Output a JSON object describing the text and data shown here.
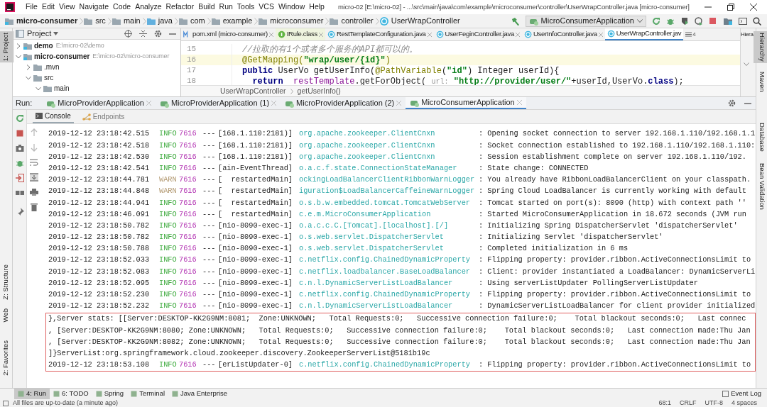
{
  "window": {
    "title": "micro-02 [E:\\micro-02] - ...\\src\\main\\java\\com\\example\\microconsumer\\controller\\UserWrapController.java [micro-consumer]"
  },
  "menu": [
    "File",
    "Edit",
    "View",
    "Navigate",
    "Code",
    "Analyze",
    "Refactor",
    "Build",
    "Run",
    "Tools",
    "VCS",
    "Window",
    "Help"
  ],
  "breadcrumbs": [
    {
      "label": "micro-consumer",
      "kind": "module"
    },
    {
      "label": "src",
      "kind": "folder"
    },
    {
      "label": "main",
      "kind": "folder"
    },
    {
      "label": "java",
      "kind": "source"
    },
    {
      "label": "com",
      "kind": "folder"
    },
    {
      "label": "example",
      "kind": "folder"
    },
    {
      "label": "microconsumer",
      "kind": "folder"
    },
    {
      "label": "controller",
      "kind": "folder"
    },
    {
      "label": "UserWrapController",
      "kind": "class"
    }
  ],
  "run_config": "MicroConsumerApplication",
  "left_stripe": [
    {
      "label": "1: Project",
      "selected": true
    },
    {
      "label": "Z: Structure",
      "selected": false
    },
    {
      "label": "Web",
      "selected": false
    },
    {
      "label": "2: Favorites",
      "selected": false
    }
  ],
  "right_stripe": [
    {
      "label": "Hierarchy",
      "selected": true
    },
    {
      "label": "Maven",
      "selected": false
    },
    {
      "label": "Database",
      "selected": false
    },
    {
      "label": "Bean Validation",
      "selected": false
    }
  ],
  "project": {
    "title": "Project",
    "tree": [
      {
        "name": "demo",
        "path": "E:\\micro-02\\demo",
        "kind": "module",
        "expanded": false
      },
      {
        "name": "micro-consumer",
        "path": "E:\\micro-02\\micro-consumer",
        "kind": "module",
        "expanded": true,
        "children": [
          {
            "name": ".mvn",
            "kind": "folder",
            "expanded": false
          },
          {
            "name": "src",
            "kind": "folder",
            "expanded": true,
            "children": [
              {
                "name": "main",
                "kind": "folder",
                "expanded": true
              }
            ]
          }
        ]
      }
    ]
  },
  "editor": {
    "tabs": [
      {
        "label": "pom.xml (micro-consumer)",
        "kind": "maven",
        "selected": false
      },
      {
        "label": "IRule.class",
        "kind": "interface",
        "selected": false
      },
      {
        "label": "RestTemplateConfiguration.java",
        "kind": "class",
        "selected": false
      },
      {
        "label": "UserFeginController.java",
        "kind": "class",
        "selected": false
      },
      {
        "label": "UserInfoController.java",
        "kind": "class",
        "selected": false
      },
      {
        "label": "UserWrapController.jav",
        "kind": "class",
        "selected": true
      }
    ],
    "overflow": "4",
    "side_panel": "Hiera",
    "lines": [
      {
        "number": "15",
        "highlighted": false,
        "tokens": [
          {
            "text": "//拉取的有1个或者多个服务的API都可以的。",
            "kind": "comment"
          }
        ]
      },
      {
        "number": "16",
        "highlighted": true,
        "tokens": [
          {
            "text": "@GetMapping(",
            "kind": "annotation"
          },
          {
            "text": "\"wrap/user/{id}\"",
            "kind": "string"
          },
          {
            "text": ")",
            "kind": "annotation"
          }
        ]
      },
      {
        "number": "17",
        "highlighted": false,
        "tokens": [
          {
            "text": "public",
            "kind": "keyword"
          },
          {
            "text": " UserVo getUserInfo(",
            "kind": "plain"
          },
          {
            "text": "@PathVariable",
            "kind": "annotation"
          },
          {
            "text": "(",
            "kind": "plain"
          },
          {
            "text": "\"id\"",
            "kind": "string"
          },
          {
            "text": ") Integer userId){",
            "kind": "plain"
          }
        ]
      },
      {
        "number": "18",
        "highlighted": false,
        "tokens": [
          {
            "text": "  return",
            "kind": "keyword"
          },
          {
            "text": "  restTemplate",
            "kind": "field"
          },
          {
            "text": ".getForObject( ",
            "kind": "plain"
          },
          {
            "text": "url:",
            "kind": "hint"
          },
          {
            "text": " \"http://provider/user/\"",
            "kind": "string"
          },
          {
            "text": "+userId,UserVo.",
            "kind": "plain"
          },
          {
            "text": "class",
            "kind": "keyword"
          },
          {
            "text": ");",
            "kind": "plain"
          }
        ]
      }
    ],
    "footer": [
      "UserWrapController",
      "getUserInfo()"
    ]
  },
  "run": {
    "label": "Run:",
    "tabs": [
      {
        "label": "MicroProviderApplication",
        "selected": false
      },
      {
        "label": "MicroProviderApplication (1)",
        "selected": false
      },
      {
        "label": "MicroProviderApplication (2)",
        "selected": false
      },
      {
        "label": "MicroConsumerApplication",
        "selected": true
      }
    ],
    "subtabs": [
      {
        "label": "Console",
        "selected": true
      },
      {
        "label": "Endpoints",
        "selected": false
      }
    ],
    "lines": [
      {
        "kind": "log",
        "time": "2019-12-12 23:18:42.515",
        "level": "INFO",
        "pid": "7616",
        "sep": "---",
        "thread": "[168.1.110:2181)]",
        "logger": "org.apache.zookeeper.ClientCnxn",
        "message": ": Opening socket connection to server 192.168.1.110/192.168.1.1"
      },
      {
        "kind": "log",
        "time": "2019-12-12 23:18:42.518",
        "level": "INFO",
        "pid": "7616",
        "sep": "---",
        "thread": "[168.1.110:2181)]",
        "logger": "org.apache.zookeeper.ClientCnxn",
        "message": ": Socket connection established to 192.168.1.110/192.168.1.110:"
      },
      {
        "kind": "log",
        "time": "2019-12-12 23:18:42.530",
        "level": "INFO",
        "pid": "7616",
        "sep": "---",
        "thread": "[168.1.110:2181)]",
        "logger": "org.apache.zookeeper.ClientCnxn",
        "message": ": Session establishment complete on server 192.168.1.110/192."
      },
      {
        "kind": "log",
        "time": "2019-12-12 23:18:42.541",
        "level": "INFO",
        "pid": "7616",
        "sep": "---",
        "thread": "[ain-EventThread]",
        "logger": "o.a.c.f.state.ConnectionStateManager",
        "message": ": State change: CONNECTED"
      },
      {
        "kind": "log",
        "time": "2019-12-12 23:18:44.781",
        "level": "WARN",
        "pid": "7616",
        "sep": "---",
        "thread": "[  restartedMain]",
        "logger": "ockingLoadBalancerClientRibbonWarnLogger",
        "message": ": You already have RibbonLoadBalancerClient on your classpath."
      },
      {
        "kind": "log",
        "time": "2019-12-12 23:18:44.848",
        "level": "WARN",
        "pid": "7616",
        "sep": "---",
        "thread": "[  restartedMain]",
        "logger": "iguration$LoadBalancerCaffeineWarnLogger",
        "message": ": Spring Cloud LoadBalancer is currently working with default"
      },
      {
        "kind": "log",
        "time": "2019-12-12 23:18:44.941",
        "level": "INFO",
        "pid": "7616",
        "sep": "---",
        "thread": "[  restartedMain]",
        "logger": "o.s.b.w.embedded.tomcat.TomcatWebServer",
        "message": ": Tomcat started on port(s): 8090 (http) with context path ''"
      },
      {
        "kind": "log",
        "time": "2019-12-12 23:18:46.091",
        "level": "INFO",
        "pid": "7616",
        "sep": "---",
        "thread": "[  restartedMain]",
        "logger": "c.e.m.MicroConsumerApplication",
        "message": ": Started MicroConsumerApplication in 18.672 seconds (JVM run"
      },
      {
        "kind": "log",
        "time": "2019-12-12 23:18:50.782",
        "level": "INFO",
        "pid": "7616",
        "sep": "---",
        "thread": "[nio-8090-exec-1]",
        "logger": "o.a.c.c.C.[Tomcat].[localhost].[/]",
        "message": ": Initializing Spring DispatcherServlet 'dispatcherServlet'"
      },
      {
        "kind": "log",
        "time": "2019-12-12 23:18:50.782",
        "level": "INFO",
        "pid": "7616",
        "sep": "---",
        "thread": "[nio-8090-exec-1]",
        "logger": "o.s.web.servlet.DispatcherServlet",
        "message": ": Initializing Servlet 'dispatcherServlet'"
      },
      {
        "kind": "log",
        "time": "2019-12-12 23:18:50.788",
        "level": "INFO",
        "pid": "7616",
        "sep": "---",
        "thread": "[nio-8090-exec-1]",
        "logger": "o.s.web.servlet.DispatcherServlet",
        "message": ": Completed initialization in 6 ms"
      },
      {
        "kind": "log",
        "time": "2019-12-12 23:18:52.033",
        "level": "INFO",
        "pid": "7616",
        "sep": "---",
        "thread": "[nio-8090-exec-1]",
        "logger": "c.netflix.config.ChainedDynamicProperty",
        "message": ": Flipping property: provider.ribbon.ActiveConnectionsLimit to"
      },
      {
        "kind": "log",
        "time": "2019-12-12 23:18:52.083",
        "level": "INFO",
        "pid": "7616",
        "sep": "---",
        "thread": "[nio-8090-exec-1]",
        "logger": "c.netflix.loadbalancer.BaseLoadBalancer",
        "message": ": Client: provider instantiated a LoadBalancer: DynamicServerLi"
      },
      {
        "kind": "log",
        "time": "2019-12-12 23:18:52.095",
        "level": "INFO",
        "pid": "7616",
        "sep": "---",
        "thread": "[nio-8090-exec-1]",
        "logger": "c.n.l.DynamicServerListLoadBalancer",
        "message": ": Using serverListUpdater PollingServerListUpdater"
      },
      {
        "kind": "log",
        "time": "2019-12-12 23:18:52.230",
        "level": "INFO",
        "pid": "7616",
        "sep": "---",
        "thread": "[nio-8090-exec-1]",
        "logger": "c.netflix.config.ChainedDynamicProperty",
        "message": ": Flipping property: provider.ribbon.ActiveConnectionsLimit to"
      },
      {
        "kind": "log",
        "time": "2019-12-12 23:18:52.232",
        "level": "INFO",
        "pid": "7616",
        "sep": "---",
        "thread": "[nio-8090-exec-1]",
        "logger": "c.n.l.DynamicServerListLoadBalancer",
        "message": ": DynamicServerListLoadBalancer for client provider initialized"
      }
    ],
    "highlighted_lines": [
      {
        "kind": "plain",
        "text": "},Server stats: [[Server:DESKTOP-KK2G9NM:8081;  Zone:UNKNOWN;   Total Requests:0;   Successive connection failure:0;    Total blackout seconds:0;   Last connec"
      },
      {
        "kind": "plain",
        "text": ", [Server:DESKTOP-KK2G9NM:8080; Zone:UNKNOWN;   Total Requests:0;   Successive connection failure:0;    Total blackout seconds:0;   Last connection made:Thu Jan"
      },
      {
        "kind": "plain",
        "text": ", [Server:DESKTOP-KK2G9NM:8082; Zone:UNKNOWN;   Total Requests:0;   Successive connection failure:0;    Total blackout seconds:0;   Last connection made:Thu Jan"
      },
      {
        "kind": "plain",
        "text": "]}ServerList:org.springframework.cloud.zookeeper.discovery.ZookeeperServerList@5181b19c"
      },
      {
        "kind": "log",
        "time": "2019-12-12 23:18:53.108",
        "level": "INFO",
        "pid": "7616",
        "sep": "---",
        "thread": "[erListUpdater-0]",
        "logger": "c.netflix.config.ChainedDynamicProperty",
        "message": ": Flipping property: provider.ribbon.ActiveConnectionsLimit to"
      }
    ]
  },
  "bottom_tools": [
    {
      "label": "4: Run",
      "selected": true
    },
    {
      "label": "6: TODO",
      "selected": false
    },
    {
      "label": "Spring",
      "selected": false
    },
    {
      "label": "Terminal",
      "selected": false
    },
    {
      "label": "Java Enterprise",
      "selected": false
    }
  ],
  "event_log": "Event Log",
  "status_bar": {
    "message": "All files are up-to-date (a minute ago)",
    "items": [
      "68:1",
      "CRLF",
      "UTF-8",
      "4 spaces"
    ]
  }
}
